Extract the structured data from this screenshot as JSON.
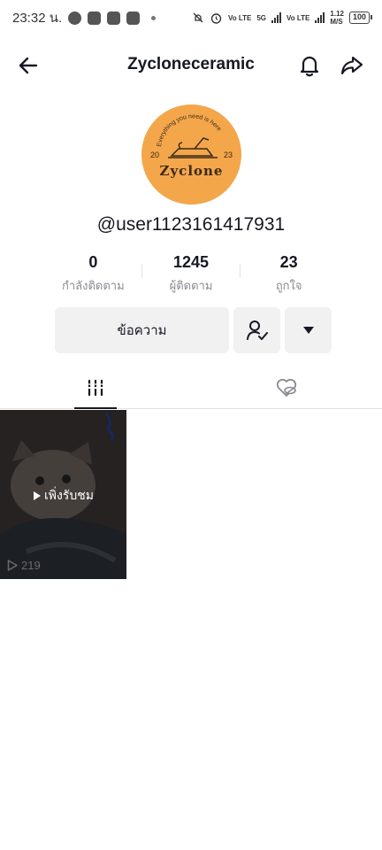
{
  "status_bar": {
    "time": "23:32 น.",
    "net_1": "Vo LTE",
    "net_2": "5G",
    "net_3": "Vo LTE",
    "speed": "1.12",
    "speed_unit": "M/S",
    "battery": "100"
  },
  "header": {
    "title": "Zycloneceramic",
    "back_icon": "arrow-left-icon",
    "bell_icon": "bell-icon",
    "share_icon": "share-icon"
  },
  "profile": {
    "avatar_text_arc": "Everything you need is here",
    "avatar_year_left": "20",
    "avatar_year_right": "23",
    "avatar_brand": "Zyclone",
    "avatar_color": "#f4a64b",
    "username": "@user1123161417931"
  },
  "stats": [
    {
      "value": "0",
      "label": "กำลังติดตาม"
    },
    {
      "value": "1245",
      "label": "ผู้ติดตาม"
    },
    {
      "value": "23",
      "label": "ถูกใจ"
    }
  ],
  "actions": {
    "message_label": "ข้อความ",
    "follow_icon": "user-check-icon",
    "more_icon": "caret-down-icon"
  },
  "tabs": [
    {
      "icon": "grid-bars-icon",
      "active": true
    },
    {
      "icon": "heart-hidden-icon",
      "active": false
    }
  ],
  "videos": [
    {
      "badge": "เพิ่งรับชม",
      "views": "219"
    }
  ]
}
